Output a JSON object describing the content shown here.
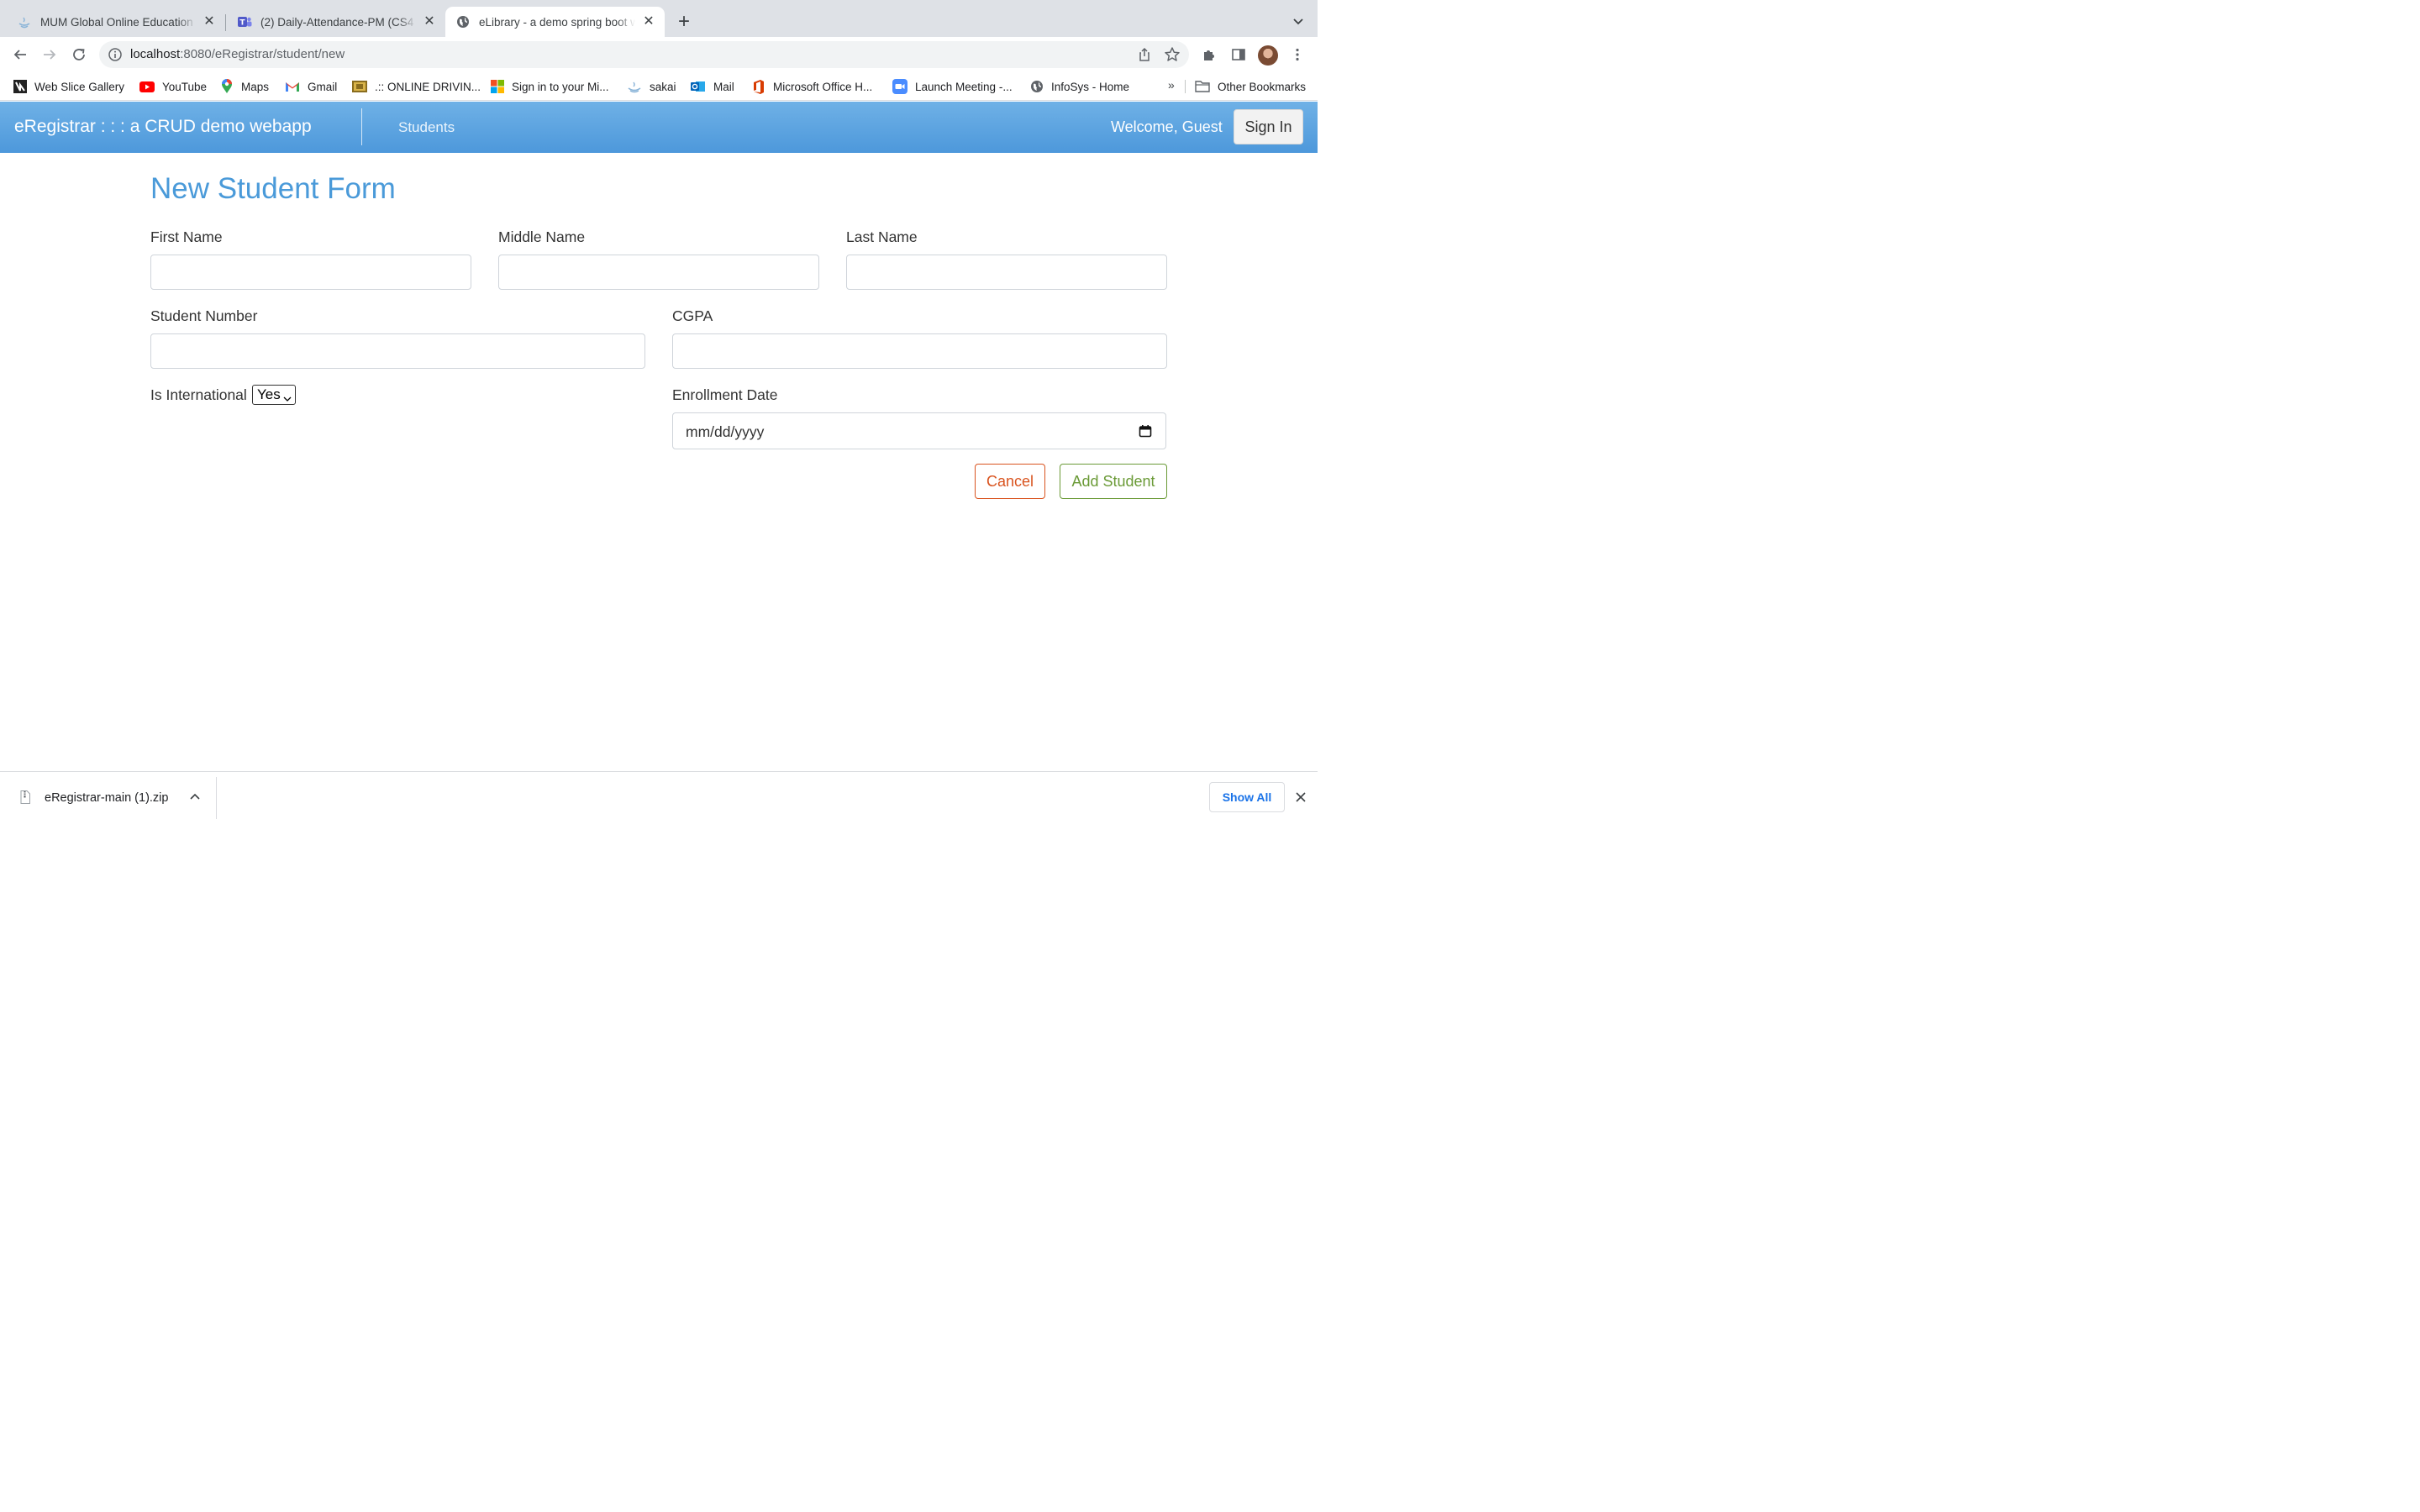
{
  "browser": {
    "tabs": [
      {
        "title": "MUM Global Online Education",
        "icon": "sakai-icon"
      },
      {
        "title": "(2) Daily-Attendance-PM (CS4",
        "icon": "teams-icon"
      },
      {
        "title": "eLibrary - a demo spring boot w",
        "icon": "globe-icon",
        "active": true
      }
    ],
    "url_host": "localhost",
    "url_path": ":8080/eRegistrar/student/new",
    "bookmarks": [
      {
        "label": "Web Slice Gallery",
        "icon": "web-slice-icon"
      },
      {
        "label": "YouTube",
        "icon": "youtube-icon"
      },
      {
        "label": "Maps",
        "icon": "maps-icon"
      },
      {
        "label": "Gmail",
        "icon": "gmail-icon"
      },
      {
        "label": ".:: ONLINE DRIVIN...",
        "icon": "driving-icon"
      },
      {
        "label": "Sign in to your Mi...",
        "icon": "microsoft-icon"
      },
      {
        "label": "sakai",
        "icon": "sakai-icon"
      },
      {
        "label": "Mail",
        "icon": "outlook-icon"
      },
      {
        "label": "Microsoft Office H...",
        "icon": "office-icon"
      },
      {
        "label": "Launch Meeting -...",
        "icon": "zoom-icon"
      },
      {
        "label": "InfoSys - Home",
        "icon": "globe-icon"
      }
    ],
    "bookmarks_overflow": "»",
    "other_bookmarks": "Other Bookmarks"
  },
  "navbar": {
    "brand": "eRegistrar : : : a CRUD demo webapp",
    "students_link": "Students",
    "welcome": "Welcome, Guest",
    "signin": "Sign In"
  },
  "form": {
    "title": "New Student Form",
    "first_name_label": "First Name",
    "middle_name_label": "Middle Name",
    "last_name_label": "Last Name",
    "student_number_label": "Student Number",
    "cgpa_label": "CGPA",
    "is_international_label": "Is International",
    "is_international_value": "Yes",
    "enrollment_date_label": "Enrollment Date",
    "enrollment_date_placeholder": "mm/dd/yyyy",
    "cancel": "Cancel",
    "add_student": "Add Student"
  },
  "downloads": {
    "file_name": "eRegistrar-main (1).zip",
    "show_all": "Show All"
  },
  "colors": {
    "navbar": "#4d98db",
    "title": "#4a9ad9",
    "cancel": "#d9531e",
    "add": "#6a9a36",
    "link_blue": "#1a73e8"
  }
}
